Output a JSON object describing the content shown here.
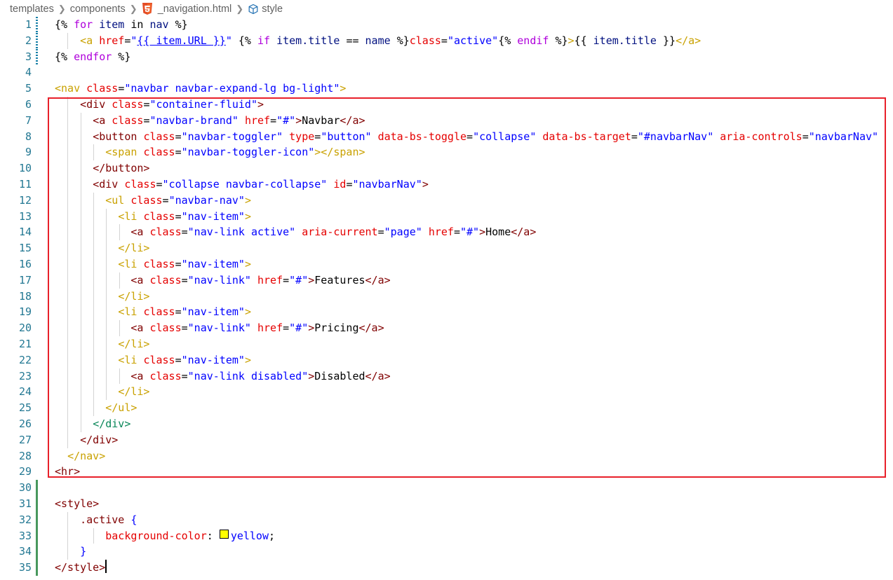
{
  "breadcrumb": {
    "items": [
      "templates",
      "components",
      "_navigation.html",
      "style"
    ],
    "file_icon": "html5-icon",
    "symbol_icon": "cube-icon"
  },
  "editor": {
    "language": "HTML",
    "lines": [
      {
        "n": "1",
        "text": "{% for item in nav %}"
      },
      {
        "n": "2",
        "text": "<a href=\"{{ item.URL }}\" {% if item.title == name %}class=\"active\"{% endif %}>{{ item.title }}</a>"
      },
      {
        "n": "3",
        "text": "{% endfor %}"
      },
      {
        "n": "4",
        "text": ""
      },
      {
        "n": "5",
        "text": "<nav class=\"navbar navbar-expand-lg bg-light\">"
      },
      {
        "n": "6",
        "text": "<div class=\"container-fluid\">"
      },
      {
        "n": "7",
        "text": "<a class=\"navbar-brand\" href=\"#\">Navbar</a>"
      },
      {
        "n": "8",
        "text": "<button class=\"navbar-toggler\" type=\"button\" data-bs-toggle=\"collapse\" data-bs-target=\"#navbarNav\" aria-controls=\"navbarNav\""
      },
      {
        "n": "9",
        "text": "<span class=\"navbar-toggler-icon\"></span>"
      },
      {
        "n": "10",
        "text": "</button>"
      },
      {
        "n": "11",
        "text": "<div class=\"collapse navbar-collapse\" id=\"navbarNav\">"
      },
      {
        "n": "12",
        "text": "<ul class=\"navbar-nav\">"
      },
      {
        "n": "13",
        "text": "<li class=\"nav-item\">"
      },
      {
        "n": "14",
        "text": "<a class=\"nav-link active\" aria-current=\"page\" href=\"#\">Home</a>"
      },
      {
        "n": "15",
        "text": "</li>"
      },
      {
        "n": "16",
        "text": "<li class=\"nav-item\">"
      },
      {
        "n": "17",
        "text": "<a class=\"nav-link\" href=\"#\">Features</a>"
      },
      {
        "n": "18",
        "text": "</li>"
      },
      {
        "n": "19",
        "text": "<li class=\"nav-item\">"
      },
      {
        "n": "20",
        "text": "<a class=\"nav-link\" href=\"#\">Pricing</a>"
      },
      {
        "n": "21",
        "text": "</li>"
      },
      {
        "n": "22",
        "text": "<li class=\"nav-item\">"
      },
      {
        "n": "23",
        "text": "<a class=\"nav-link disabled\">Disabled</a>"
      },
      {
        "n": "24",
        "text": "</li>"
      },
      {
        "n": "25",
        "text": "</ul>"
      },
      {
        "n": "26",
        "text": "</div>"
      },
      {
        "n": "27",
        "text": "</div>"
      },
      {
        "n": "28",
        "text": "</nav>"
      },
      {
        "n": "29",
        "text": "<hr>"
      },
      {
        "n": "30",
        "text": ""
      },
      {
        "n": "31",
        "text": "<style>"
      },
      {
        "n": "32",
        "text": ".active {"
      },
      {
        "n": "33",
        "text": "background-color: yellow;"
      },
      {
        "n": "34",
        "text": "}"
      },
      {
        "n": "35",
        "text": "</style>"
      }
    ]
  },
  "colors": {
    "highlight_box": "#e8202a",
    "line_number": "#237893",
    "tag": "#800000",
    "attribute": "#e50000",
    "string": "#0000ff",
    "keyword": "#af00db",
    "variable": "#001080",
    "gutter_added": "#48985d",
    "gutter_modified": "#1b81a8",
    "color_swatch": "#ffff00"
  }
}
